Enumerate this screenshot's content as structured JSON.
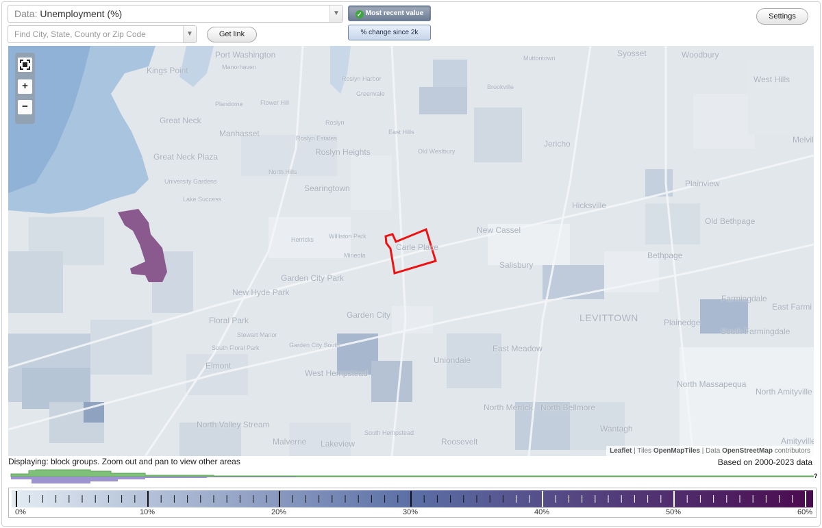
{
  "header": {
    "data_prefix": "Data:",
    "data_value": "Unemployment (%)",
    "search_placeholder": "Find City, State, County or Zip Code",
    "get_link_label": "Get link",
    "settings_label": "Settings",
    "mode_most_recent": "Most recent value",
    "mode_change": "% change since 2k",
    "active_mode": "Most recent value"
  },
  "map": {
    "zoom_controls": {
      "fit_icon": "fullscreen-icon",
      "zoom_in": "+",
      "zoom_out": "−"
    },
    "places": [
      "Port Washington",
      "Kings Point",
      "Manorhaven",
      "Roslyn Harbor",
      "Muttontown",
      "Syosset",
      "Woodbury",
      "Great Neck",
      "Plandome",
      "Flower Hill",
      "Greenvale",
      "Brookville",
      "West Hills",
      "Manhasset",
      "Roslyn",
      "East Hills",
      "Roslyn Estates",
      "Old Westbury",
      "Jericho",
      "Melvil",
      "Great Neck Plaza",
      "Roslyn Heights",
      "North Hills",
      "University Gardens",
      "Searingtown",
      "Plainview",
      "Lake Success",
      "Hicksville",
      "Old Bethpage",
      "New Cassel",
      "Herricks",
      "Williston Park",
      "Carle Place",
      "Mineola",
      "Salisbury",
      "Bethpage",
      "Garden City Park",
      "New Hyde Park",
      "Farmingdale",
      "East Farmi",
      "Floral Park",
      "Garden City",
      "LEVITTOWN",
      "Plainedge",
      "South Farmingdale",
      "Stewart Manor",
      "South Floral Park",
      "Garden City South",
      "Elmont",
      "Uniondale",
      "East Meadow",
      "West Hempstead",
      "North Massapequa",
      "North Amityville",
      "North Valley Stream",
      "North Merrick",
      "North Bellmore",
      "Malverne",
      "South Hempstead",
      "Wantagh",
      "Lakeview",
      "Roosevelt",
      "Amityville"
    ],
    "attribution": {
      "leaflet": "Leaflet",
      "tiles_prefix": " | Tiles ",
      "tiles": "OpenMapTiles",
      "data_prefix": " | Data ",
      "data": "OpenStreetMap",
      "suffix": " contributors"
    },
    "highlight_color": "#ee1111",
    "high_value_color": "#8a5a8f"
  },
  "footer": {
    "display_note": "Displaying: block groups. Zoom out and pan to view other areas",
    "based_on": "Based on 2000-2023 data",
    "unknown_mark": "?"
  },
  "legend": {
    "scale_min": 0,
    "scale_max": 62,
    "tick_labels": [
      "0%",
      "10%",
      "20%",
      "30%",
      "40%",
      "50%",
      "60%"
    ],
    "color_start": "#e3ecf3",
    "color_mid": "#5b6fa5",
    "color_end": "#4a0a4e"
  },
  "histogram": {
    "top_color": "#7ec07a",
    "bottom_color": "#9c93cf"
  }
}
